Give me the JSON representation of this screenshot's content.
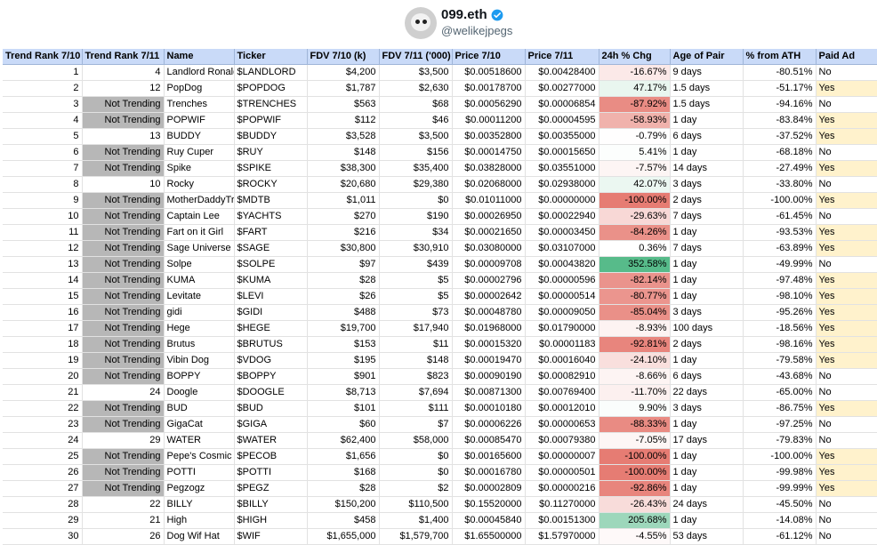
{
  "profile": {
    "name": "099.eth",
    "handle": "@welikejpegs"
  },
  "table": {
    "headers": [
      "Trend Rank 7/10",
      "Trend Rank 7/11",
      "Name",
      "Ticker",
      "FDV 7/10 (k)",
      "FDV 7/11 ('000)",
      "Price 7/10",
      "Price 7/11",
      "24h % Chg",
      "Age of Pair",
      "% from ATH",
      "Paid Ad"
    ],
    "rows": [
      [
        "1",
        "4",
        "Landlord Ronald",
        "$LANDLORD",
        "$4,200",
        "$3,500",
        "$0.00518600",
        "$0.00428400",
        "-16.67%",
        "9 days",
        "-80.51%",
        "No"
      ],
      [
        "2",
        "12",
        "PopDog",
        "$POPDOG",
        "$1,787",
        "$2,630",
        "$0.00178700",
        "$0.00277000",
        "47.17%",
        "1.5 days",
        "-51.17%",
        "Yes"
      ],
      [
        "3",
        "Not Trending",
        "Trenches",
        "$TRENCHES",
        "$563",
        "$68",
        "$0.00056290",
        "$0.00006854",
        "-87.92%",
        "1.5 days",
        "-94.16%",
        "No"
      ],
      [
        "4",
        "Not Trending",
        "POPWIF",
        "$POPWIF",
        "$112",
        "$46",
        "$0.00011200",
        "$0.00004595",
        "-58.93%",
        "1 day",
        "-83.84%",
        "Yes"
      ],
      [
        "5",
        "13",
        "BUDDY",
        "$BUDDY",
        "$3,528",
        "$3,500",
        "$0.00352800",
        "$0.00355000",
        "-0.79%",
        "6 days",
        "-37.52%",
        "Yes"
      ],
      [
        "6",
        "Not Trending",
        "Ruy Cuper",
        "$RUY",
        "$148",
        "$156",
        "$0.00014750",
        "$0.00015650",
        "5.41%",
        "1 day",
        "-68.18%",
        "No"
      ],
      [
        "7",
        "Not Trending",
        "Spike",
        "$SPIKE",
        "$38,300",
        "$35,400",
        "$0.03828000",
        "$0.03551000",
        "-7.57%",
        "14 days",
        "-27.49%",
        "Yes"
      ],
      [
        "8",
        "10",
        "Rocky",
        "$ROCKY",
        "$20,680",
        "$29,380",
        "$0.02068000",
        "$0.02938000",
        "42.07%",
        "3 days",
        "-33.80%",
        "No"
      ],
      [
        "9",
        "Not Trending",
        "MotherDaddyTre",
        "$MDTB",
        "$1,011",
        "$0",
        "$0.01011000",
        "$0.00000000",
        "-100.00%",
        "2 days",
        "-100.00%",
        "Yes"
      ],
      [
        "10",
        "Not Trending",
        "Captain Lee",
        "$YACHTS",
        "$270",
        "$190",
        "$0.00026950",
        "$0.00022940",
        "-29.63%",
        "7 days",
        "-61.45%",
        "No"
      ],
      [
        "11",
        "Not Trending",
        "Fart on it Girl",
        "$FART",
        "$216",
        "$34",
        "$0.00021650",
        "$0.00003450",
        "-84.26%",
        "1 day",
        "-93.53%",
        "Yes"
      ],
      [
        "12",
        "Not Trending",
        "Sage Universe",
        "$SAGE",
        "$30,800",
        "$30,910",
        "$0.03080000",
        "$0.03107000",
        "0.36%",
        "7 days",
        "-63.89%",
        "Yes"
      ],
      [
        "13",
        "Not Trending",
        "Solpe",
        "$SOLPE",
        "$97",
        "$439",
        "$0.00009708",
        "$0.00043820",
        "352.58%",
        "1 day",
        "-49.99%",
        "No"
      ],
      [
        "14",
        "Not Trending",
        "KUMA",
        "$KUMA",
        "$28",
        "$5",
        "$0.00002796",
        "$0.00000596",
        "-82.14%",
        "1 day",
        "-97.48%",
        "Yes"
      ],
      [
        "15",
        "Not Trending",
        "Levitate",
        "$LEVI",
        "$26",
        "$5",
        "$0.00002642",
        "$0.00000514",
        "-80.77%",
        "1 day",
        "-98.10%",
        "Yes"
      ],
      [
        "16",
        "Not Trending",
        "gidi",
        "$GIDI",
        "$488",
        "$73",
        "$0.00048780",
        "$0.00009050",
        "-85.04%",
        "3 days",
        "-95.26%",
        "Yes"
      ],
      [
        "17",
        "Not Trending",
        "Hege",
        "$HEGE",
        "$19,700",
        "$17,940",
        "$0.01968000",
        "$0.01790000",
        "-8.93%",
        "100 days",
        "-18.56%",
        "Yes"
      ],
      [
        "18",
        "Not Trending",
        "Brutus",
        "$BRUTUS",
        "$153",
        "$11",
        "$0.00015320",
        "$0.00001183",
        "-92.81%",
        "2 days",
        "-98.16%",
        "Yes"
      ],
      [
        "19",
        "Not Trending",
        "Vibin Dog",
        "$VDOG",
        "$195",
        "$148",
        "$0.00019470",
        "$0.00016040",
        "-24.10%",
        "1 day",
        "-79.58%",
        "Yes"
      ],
      [
        "20",
        "Not Trending",
        "BOPPY",
        "$BOPPY",
        "$901",
        "$823",
        "$0.00090190",
        "$0.00082910",
        "-8.66%",
        "6 days",
        "-43.68%",
        "No"
      ],
      [
        "21",
        "24",
        "Doogle",
        "$DOOGLE",
        "$8,713",
        "$7,694",
        "$0.00871300",
        "$0.00769400",
        "-11.70%",
        "22 days",
        "-65.00%",
        "No"
      ],
      [
        "22",
        "Not Trending",
        "BUD",
        "$BUD",
        "$101",
        "$111",
        "$0.00010180",
        "$0.00012010",
        "9.90%",
        "3 days",
        "-86.75%",
        "Yes"
      ],
      [
        "23",
        "Not Trending",
        "GigaCat",
        "$GIGA",
        "$60",
        "$7",
        "$0.00006226",
        "$0.00000653",
        "-88.33%",
        "1 day",
        "-97.25%",
        "No"
      ],
      [
        "24",
        "29",
        "WATER",
        "$WATER",
        "$62,400",
        "$58,000",
        "$0.00085470",
        "$0.00079380",
        "-7.05%",
        "17 days",
        "-79.83%",
        "No"
      ],
      [
        "25",
        "Not Trending",
        "Pepe's Cosmic E",
        "$PECOB",
        "$1,656",
        "$0",
        "$0.00165600",
        "$0.00000007",
        "-100.00%",
        "1 day",
        "-100.00%",
        "Yes"
      ],
      [
        "26",
        "Not Trending",
        "POTTI",
        "$POTTI",
        "$168",
        "$0",
        "$0.00016780",
        "$0.00000501",
        "-100.00%",
        "1 day",
        "-99.98%",
        "Yes"
      ],
      [
        "27",
        "Not Trending",
        "Pegzogz",
        "$PEGZ",
        "$28",
        "$2",
        "$0.00002809",
        "$0.00000216",
        "-92.86%",
        "1 day",
        "-99.99%",
        "Yes"
      ],
      [
        "28",
        "22",
        "BILLY",
        "$BILLY",
        "$150,200",
        "$110,500",
        "$0.15520000",
        "$0.11270000",
        "-26.43%",
        "24 days",
        "-45.50%",
        "No"
      ],
      [
        "29",
        "21",
        "High",
        "$HIGH",
        "$458",
        "$1,400",
        "$0.00045840",
        "$0.00151300",
        "205.68%",
        "1 day",
        "-14.08%",
        "No"
      ],
      [
        "30",
        "26",
        "Dog Wif Hat",
        "$WIF",
        "$1,655,000",
        "$1,579,700",
        "$1.65500000",
        "$1.57970000",
        "-4.55%",
        "53 days",
        "-61.12%",
        "No"
      ]
    ]
  }
}
